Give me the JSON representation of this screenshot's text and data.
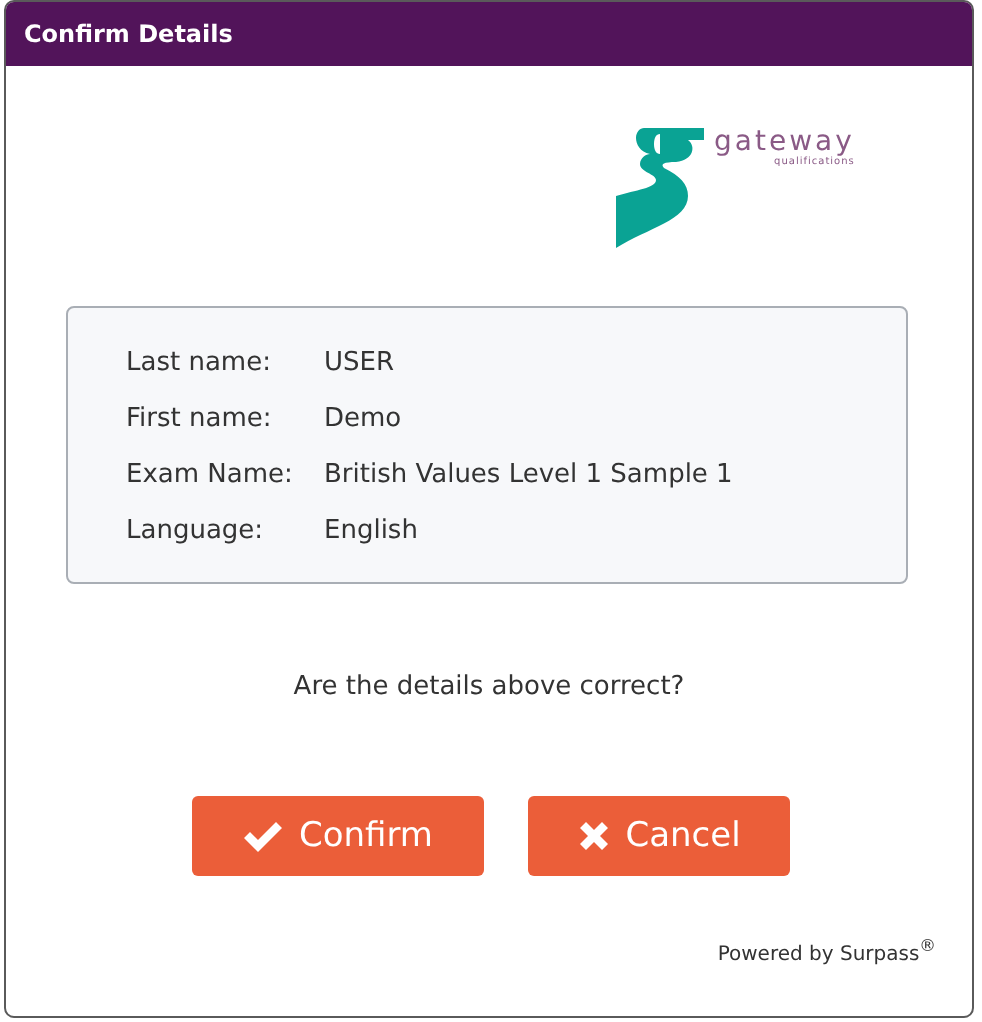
{
  "window": {
    "title": "Confirm Details"
  },
  "logo": {
    "name": "gateway",
    "tagline": "qualifications"
  },
  "details": [
    {
      "label": "Last name:",
      "value": "USER"
    },
    {
      "label": "First name:",
      "value": "Demo"
    },
    {
      "label": "Exam Name:",
      "value": "British Values Level 1 Sample 1"
    },
    {
      "label": "Language:",
      "value": "English"
    }
  ],
  "question": "Are the details above correct?",
  "buttons": [
    {
      "kind": "confirm",
      "label": "Confirm"
    },
    {
      "kind": "cancel",
      "label": "Cancel"
    }
  ],
  "footer": "Powered by Surpass$^{®}$"
}
